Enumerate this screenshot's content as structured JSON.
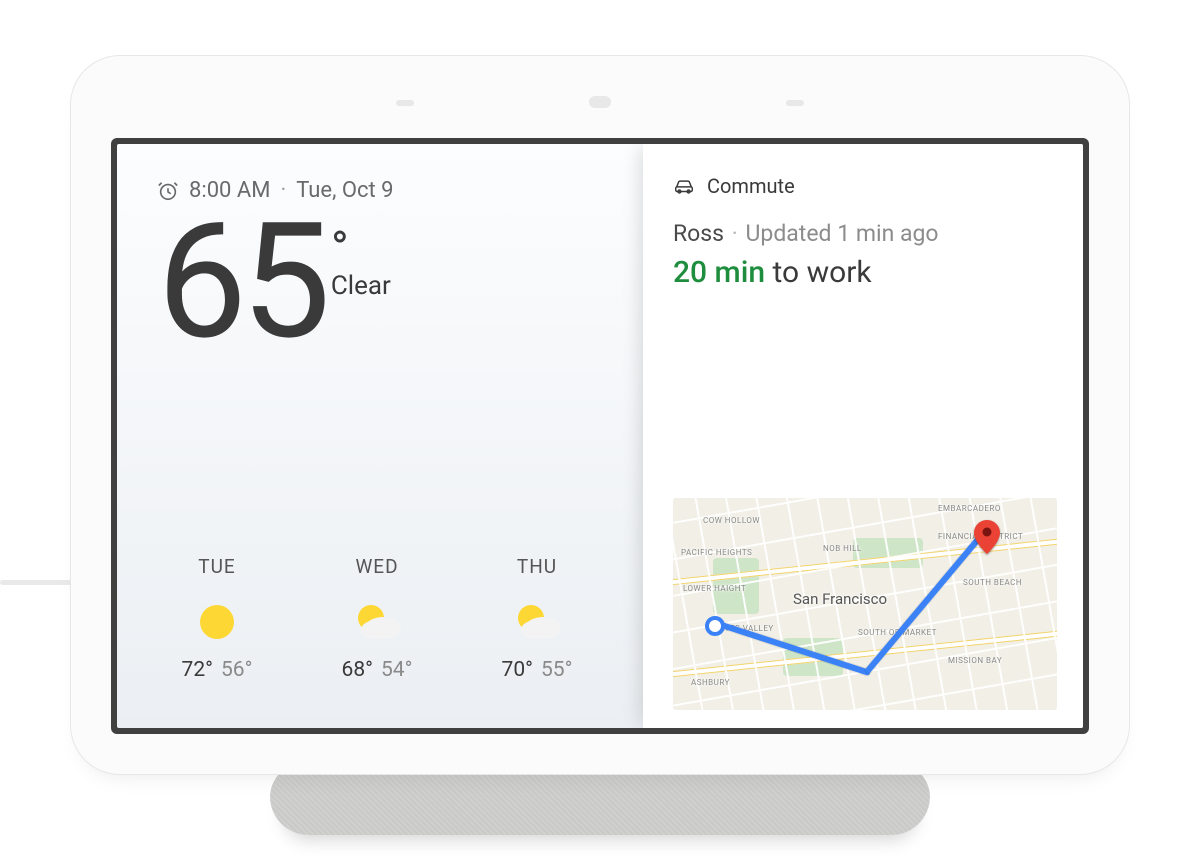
{
  "clock": {
    "icon": "alarm-icon",
    "time": "8:00 AM",
    "separator": "·",
    "date": "Tue, Oct 9"
  },
  "weather": {
    "temperature": "65",
    "degree": "°",
    "condition": "Clear",
    "forecast": [
      {
        "day": "TUE",
        "hi": "72°",
        "lo": "56°",
        "icon": "sunny"
      },
      {
        "day": "WED",
        "hi": "68°",
        "lo": "54°",
        "icon": "partly-cloudy"
      },
      {
        "day": "THU",
        "hi": "70°",
        "lo": "55°",
        "icon": "partly-cloudy"
      }
    ]
  },
  "commute": {
    "icon": "car-icon",
    "title": "Commute",
    "source": "Ross",
    "separator": "·",
    "updated": "Updated 1 min ago",
    "eta": "20 min",
    "eta_suffix": "to work",
    "map": {
      "city": "San Francisco",
      "districts": [
        "EMBARCADERO",
        "COW HOLLOW",
        "FINANCIAL DISTRICT",
        "PACIFIC HEIGHTS",
        "NOB HILL",
        "SOUTH BEACH",
        "LOWER HAIGHT",
        "HAYES VALLEY",
        "SOUTH OF MARKET",
        "MISSION BAY",
        "ASHBURY"
      ]
    }
  }
}
